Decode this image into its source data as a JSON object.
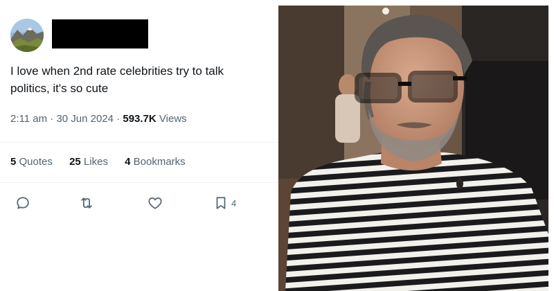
{
  "tweet": {
    "text": "I love when 2nd rate celebrities try to talk\npolitics, it's so cute",
    "time": "2:11 am",
    "date": "30 Jun 2024",
    "views_count": "593.7K",
    "views_label": "Views",
    "separator": "·"
  },
  "stats": {
    "quotes_count": "5",
    "quotes_label": "Quotes",
    "likes_count": "25",
    "likes_label": "Likes",
    "bookmarks_count": "4",
    "bookmarks_label": "Bookmarks"
  },
  "actions": {
    "bookmark_count": "4"
  },
  "icons": [
    "reply-icon",
    "retweet-icon",
    "like-icon",
    "bookmark-icon"
  ],
  "colors": {
    "text_primary": "#0f1419",
    "text_secondary": "#536471",
    "divider": "#eff3f4",
    "redaction": "#000000"
  }
}
